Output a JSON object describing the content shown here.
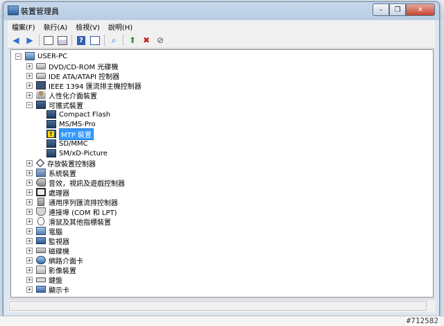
{
  "window": {
    "title": "裝置管理員"
  },
  "menu": [
    {
      "label": "檔案(F)"
    },
    {
      "label": "執行(A)"
    },
    {
      "label": "檢視(V)"
    },
    {
      "label": "說明(H)"
    }
  ],
  "toolbar_icons": [
    "back-arrow-icon",
    "forward-arrow-icon",
    "properties-icon",
    "tree-view-icon",
    "help-icon",
    "view-icon",
    "scan-hardware-icon",
    "update-driver-icon",
    "uninstall-icon",
    "disable-device-icon"
  ],
  "tree": {
    "root": "USER-PC",
    "categories": [
      {
        "label": "DVD/CD-ROM 光碟機",
        "icon": "dvd-drive-icon",
        "expanded": false
      },
      {
        "label": "IDE ATA/ATAPI 控制器",
        "icon": "ide-controller-icon",
        "expanded": false
      },
      {
        "label": "IEEE 1394 匯流排主機控制器",
        "icon": "ieee1394-icon",
        "expanded": false
      },
      {
        "label": "人性化介面裝置",
        "icon": "hid-icon",
        "expanded": false
      },
      {
        "label": "可攜式裝置",
        "icon": "portable-device-icon",
        "expanded": true,
        "children": [
          {
            "label": "Compact Flash",
            "warning": false,
            "selected": false
          },
          {
            "label": "MS/MS-Pro",
            "warning": false,
            "selected": false
          },
          {
            "label": "MTP 裝置",
            "warning": true,
            "selected": true
          },
          {
            "label": "SD/MMC",
            "warning": false,
            "selected": false
          },
          {
            "label": "SM/xD-Picture",
            "warning": false,
            "selected": false
          }
        ]
      },
      {
        "label": "存放裝置控制器",
        "icon": "storage-controller-icon",
        "expanded": false
      },
      {
        "label": "系統裝置",
        "icon": "system-device-icon",
        "expanded": false
      },
      {
        "label": "音效，視訊及遊戲控制器",
        "icon": "sound-icon",
        "expanded": false
      },
      {
        "label": "處理器",
        "icon": "processor-icon",
        "expanded": false
      },
      {
        "label": "通用序列匯流排控制器",
        "icon": "usb-icon",
        "expanded": false
      },
      {
        "label": "連接埠 (COM 和 LPT)",
        "icon": "port-icon",
        "expanded": false
      },
      {
        "label": "滑鼠及其他指標裝置",
        "icon": "mouse-icon",
        "expanded": false
      },
      {
        "label": "電腦",
        "icon": "computer-icon",
        "expanded": false
      },
      {
        "label": "監視器",
        "icon": "monitor-icon",
        "expanded": false
      },
      {
        "label": "磁碟機",
        "icon": "disk-drive-icon",
        "expanded": false
      },
      {
        "label": "網路介面卡",
        "icon": "network-adapter-icon",
        "expanded": false
      },
      {
        "label": "影像裝置",
        "icon": "imaging-device-icon",
        "expanded": false
      },
      {
        "label": "鍵盤",
        "icon": "keyboard-icon",
        "expanded": false
      },
      {
        "label": "顯示卡",
        "icon": "display-adapter-icon",
        "expanded": false
      }
    ]
  },
  "watermark": "#712582"
}
